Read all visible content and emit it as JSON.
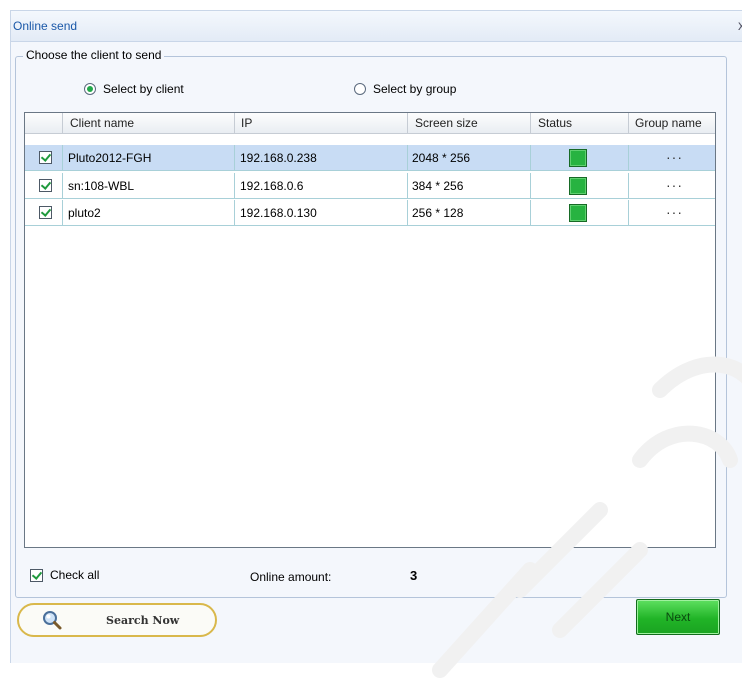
{
  "window": {
    "title": "Online send",
    "close_glyph": "x"
  },
  "group": {
    "legend": "Choose the client to send"
  },
  "radios": {
    "by_client": {
      "label": "Select by client",
      "selected": true
    },
    "by_group": {
      "label": "Select by group",
      "selected": false
    }
  },
  "table": {
    "headers": [
      "Client name",
      "IP",
      "Screen size",
      "Status",
      "Group name"
    ],
    "rows": [
      {
        "checked": true,
        "client": "Pluto2012-FGH",
        "ip": "192.168.0.238",
        "size": "2048 * 256",
        "status": "online",
        "group": "···"
      },
      {
        "checked": true,
        "client": "sn:108-WBL",
        "ip": "192.168.0.6",
        "size": "384 * 256",
        "status": "online",
        "group": "···"
      },
      {
        "checked": true,
        "client": "pluto2",
        "ip": "192.168.0.130",
        "size": "256 * 128",
        "status": "online",
        "group": "···"
      }
    ]
  },
  "footer": {
    "check_all_label": "Check all",
    "online_amount_label": "Online amount:",
    "online_amount_value": "3",
    "search_button": "Search Now",
    "next_button": "Next"
  },
  "colors": {
    "accent_green": "#21b427",
    "title_blue": "#1a58a8",
    "search_border": "#d9b84b"
  }
}
